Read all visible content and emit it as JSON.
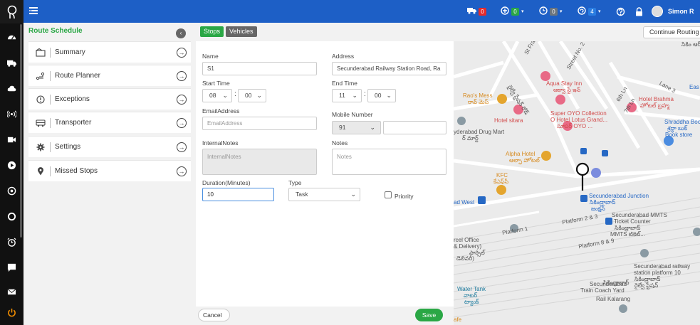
{
  "topbar": {
    "menu_icon": "menu-icon",
    "items": [
      {
        "icon": "truck-icon",
        "count": "0",
        "color": "#e52b2b"
      },
      {
        "icon": "plus-circle-icon",
        "count": "0",
        "color": "#2aa745"
      },
      {
        "icon": "clock-icon",
        "count": "0",
        "color": "#6c757d"
      },
      {
        "icon": "refresh-icon",
        "count": "4",
        "color": "#2a7de1"
      }
    ],
    "user_name": "Simon R"
  },
  "sidebar_rail": {
    "icons": [
      "speedometer-icon",
      "truck-icon",
      "cloud-icon",
      "signal-icon",
      "video-icon",
      "play-circle-icon",
      "target-icon",
      "circle-icon",
      "alarm-icon",
      "chat-icon",
      "mail-icon",
      "power-icon"
    ]
  },
  "route_schedule": {
    "title": "Route Schedule",
    "items": [
      {
        "label": "Summary",
        "icon": "summary-icon"
      },
      {
        "label": "Route Planner",
        "icon": "route-icon"
      },
      {
        "label": "Exceptions",
        "icon": "exclamation-icon"
      },
      {
        "label": "Transporter",
        "icon": "bus-icon"
      },
      {
        "label": "Settings",
        "icon": "gear-icon"
      },
      {
        "label": "Missed Stops",
        "icon": "map-pin-icon"
      }
    ]
  },
  "tabs": {
    "stops": "Stops",
    "vehicles": "Vehicles"
  },
  "continue_label": "Continue Routing",
  "form": {
    "name_label": "Name",
    "name_value": "S1",
    "address_label": "Address",
    "address_value": "Secunderabad Railway Station Road, Ra",
    "start_time_label": "Start Time",
    "start_hour": "08",
    "start_min": "00",
    "end_time_label": "End Time",
    "end_hour": "11",
    "end_min": "00",
    "email_label": "EmailAddress",
    "email_placeholder": "EmailAddress",
    "mobile_label": "Mobile Number",
    "mobile_code": "91",
    "internal_notes_label": "InternalNotes",
    "internal_notes_placeholder": "InternalNotes",
    "notes_label": "Notes",
    "notes_placeholder": "Notes",
    "duration_label": "Duration(Minutes)",
    "duration_value": "10",
    "type_label": "Type",
    "type_value": "Task",
    "priority_label": "Priority"
  },
  "footer": {
    "cancel": "Cancel",
    "save": "Save"
  },
  "map": {
    "labels": {
      "aqua": "Aqua Stay Inn",
      "aqua_te": "ఆక్వా స్టే ఇన్",
      "raos": "Rao's Mess",
      "raos_te": "రావ్ మెస్",
      "hotel_sitara": "Hotel sitara",
      "oyo1": "Super OYO Collection",
      "oyo2": "O Hotel Lotus Grand...",
      "oyo_te": "సూపర్ OYO ...",
      "brahma": "Hotel Brahma",
      "brahma_te": "హోటల్ బ్రహ్మ",
      "shraddha1": "Shraddha Boo",
      "shraddha_te": "శ్రద్ధా బుక్",
      "shraddha2": "Book store",
      "drug1": "yderabad Drug Mart",
      "drug_te": "ర్ మార్ట్",
      "alpha": "Alpha Hotel",
      "alpha_te": "ఆల్ఫా హోటల్",
      "kfc": "KFC",
      "kfc_te": "కేఎఫ్‌సీ",
      "junction": "Secunderabad Junction",
      "junction_te1": "సికింద్రాబాద్",
      "junction_te2": "జంక్షన్",
      "ad_west": "ad West",
      "mmts1": "Secunderabad MMTS",
      "mmts2": "Ticket Counter",
      "mmts_te1": "సికింద్రాబాద్",
      "mmts_te2": "MMTS టికెట్...",
      "platform1": "Platform 1",
      "platform23": "Platform 2 & 3",
      "platform89": "Platform 8 & 9",
      "parcel1": "rcel Office",
      "parcel2": "& Delivery)",
      "parcel_te1": "పార్సిల్",
      "parcel_te2": "డెలివరీ)",
      "railway1": "Secunderabad railway",
      "railway2": "station platform 10",
      "railway_te1": "సికింద్రాబాద్",
      "railway_te2": "రైల్వే స్టేషన్",
      "coach1": "Secunderabad",
      "coach_te": "సికింద్రాబాద్",
      "coach2": "Train Coach Yard",
      "kalarang": "Rail Kalarang",
      "water1": "Water Tank",
      "water_te1": "వాటర్",
      "water_te2": "ట్యాంక్",
      "afe": "afe",
      "street2": "Street No. 2",
      "lane3": "Lane 3",
      "st_fra": "St Fra",
      "sixth_ln": "6th Ln",
      "seventh_ln": "7th Ln",
      "eas": "Eas",
      "road_te": "రైల్వే స్టేషన్ రోడ్",
      "top_right_te": "సికిం ఆర్"
    }
  }
}
